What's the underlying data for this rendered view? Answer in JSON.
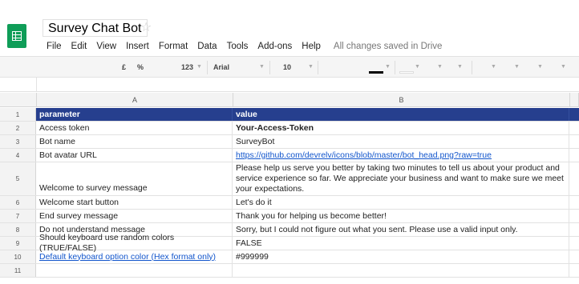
{
  "document": {
    "title": "Survey Chat Bot"
  },
  "menu": [
    "File",
    "Edit",
    "View",
    "Insert",
    "Format",
    "Data",
    "Tools",
    "Add-ons",
    "Help"
  ],
  "save_status": "All changes saved in Drive",
  "toolbar": {
    "currency": "£",
    "percent": "%",
    "number_format": "123",
    "font": "Arial",
    "font_size": "10",
    "text_color": "#000000",
    "fill_color": "#ffffff"
  },
  "columns": [
    "A",
    "B"
  ],
  "rows": [
    {
      "num": "1",
      "a": "parameter",
      "b": "value"
    },
    {
      "num": "2",
      "a": "Access token",
      "b": "Your-Access-Token"
    },
    {
      "num": "3",
      "a": "Bot name",
      "b": "SurveyBot"
    },
    {
      "num": "4",
      "a": "Bot avatar URL",
      "b": "https://github.com/devrelv/icons/blob/master/bot_head.png?raw=true"
    },
    {
      "num": "5",
      "a": "Welcome to survey message",
      "b": "Please help us serve you better by taking two minutes to tell us about your product and service experience so far. We appreciate your business and want to make sure we meet your expectations."
    },
    {
      "num": "6",
      "a": "Welcome start button",
      "b": "Let's do it"
    },
    {
      "num": "7",
      "a": "End survey message",
      "b": "Thank you for helping us become better!"
    },
    {
      "num": "8",
      "a": "Do not understand message",
      "b": "Sorry, but I could not figure out what you sent. Please use a valid input only."
    },
    {
      "num": "9",
      "a": "Should keyboard use random colors (TRUE/FALSE)",
      "b": "FALSE"
    },
    {
      "num": "10",
      "a": "Default keyboard option color (Hex format only)",
      "b": "#999999"
    },
    {
      "num": "11",
      "a": "",
      "b": ""
    }
  ],
  "colors": {
    "header_fill": "#263f8e",
    "link": "#1155cc",
    "brand": "#0f9d58"
  }
}
